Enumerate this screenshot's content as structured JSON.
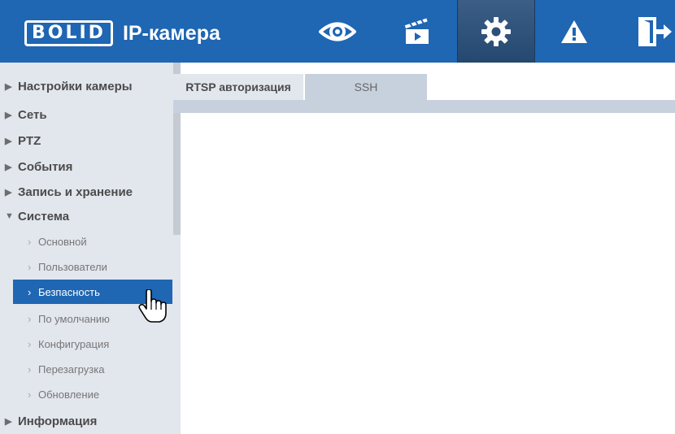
{
  "header": {
    "logo": "BOLID",
    "title": "IP-камера",
    "nav": [
      {
        "icon": "eye-icon",
        "label": "live-view"
      },
      {
        "icon": "clapperboard-icon",
        "label": "playback"
      },
      {
        "icon": "gear-icon",
        "label": "settings",
        "active": true
      },
      {
        "icon": "warning-icon",
        "label": "alarm"
      },
      {
        "icon": "logout-icon",
        "label": "logout"
      }
    ]
  },
  "sidebar": {
    "sections": [
      {
        "label": "Настройки камеры",
        "expanded": false
      },
      {
        "label": "Сеть",
        "expanded": false
      },
      {
        "label": "PTZ",
        "expanded": false
      },
      {
        "label": "События",
        "expanded": false
      },
      {
        "label": "Запись и хранение",
        "expanded": false
      },
      {
        "label": "Система",
        "expanded": true
      },
      {
        "label": "Информация",
        "expanded": false
      }
    ],
    "system_items": [
      {
        "label": "Основной"
      },
      {
        "label": "Пользователи"
      },
      {
        "label": "Безпасность",
        "active": true
      },
      {
        "label": "По умолчанию"
      },
      {
        "label": "Конфигурация"
      },
      {
        "label": "Перезагрузка"
      },
      {
        "label": "Обновление"
      }
    ]
  },
  "tabs": [
    {
      "label": "RTSP авторизация",
      "active": true
    },
    {
      "label": "SSH",
      "active": false
    }
  ],
  "colors": {
    "header": "#1f66b3",
    "sidebar": "#e2e6ed",
    "active_item": "#1f66b3",
    "tab_inactive": "#c7d1de"
  }
}
